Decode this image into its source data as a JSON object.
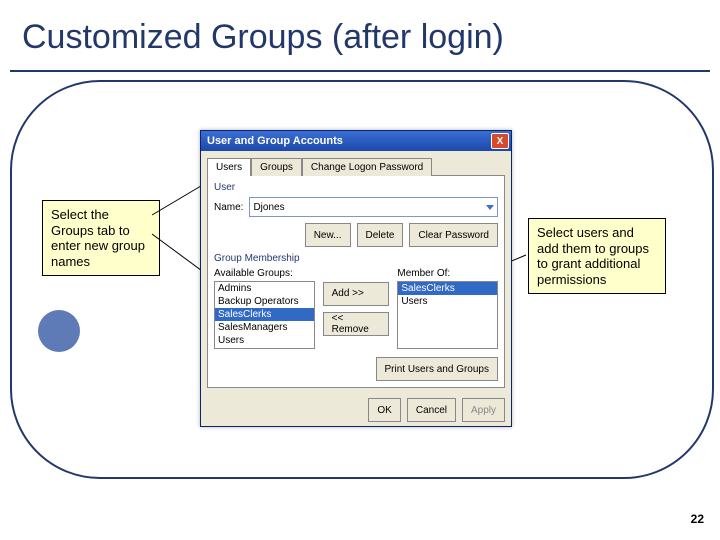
{
  "title": "Customized Groups (after login)",
  "pagenum": "22",
  "callout_left": "Select the Groups tab to enter new group names",
  "callout_right": "Select users and add them to groups to grant additional permissions",
  "dialog": {
    "title": "User and Group Accounts",
    "close": "X",
    "tabs": {
      "t1": "Users",
      "t2": "Groups",
      "t3": "Change Logon Password"
    },
    "user_section_label": "User",
    "name_label": "Name:",
    "name_value": "Djones",
    "btn_new": "New...",
    "btn_delete": "Delete",
    "btn_clearpw": "Clear Password",
    "gm_title": "Group Membership",
    "avail_label": "Available Groups:",
    "member_label": "Member Of:",
    "avail": {
      "a0": "Admins",
      "a1": "Backup Operators",
      "a2": "SalesClerks",
      "a3": "SalesManagers",
      "a4": "Users"
    },
    "member": {
      "m0": "SalesClerks",
      "m1": "Users"
    },
    "btn_add": "Add >>",
    "btn_remove": "<< Remove",
    "btn_print": "Print Users and Groups",
    "btn_ok": "OK",
    "btn_cancel": "Cancel",
    "btn_apply": "Apply"
  }
}
